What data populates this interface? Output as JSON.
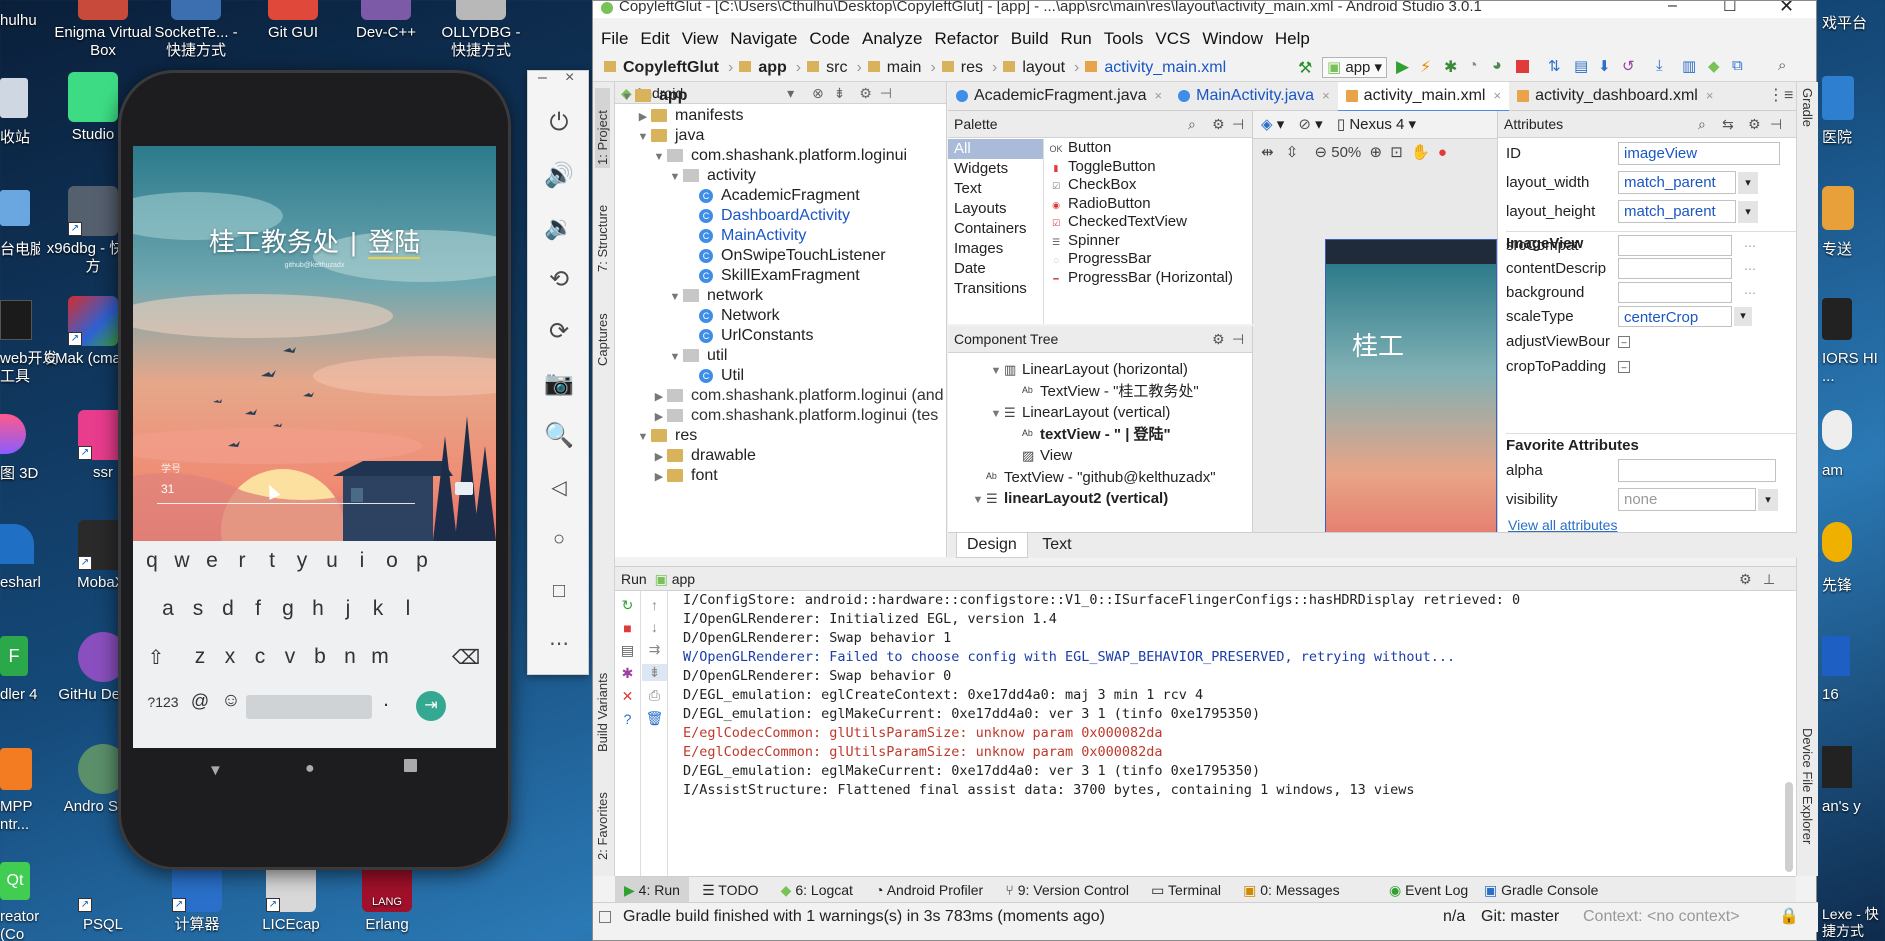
{
  "window": {
    "title": "CopyleftGlut - [C:\\Users\\Cthulhu\\Desktop\\CopyleftGlut] - [app] - ...\\app\\src\\main\\res\\layout\\activity_main.xml - Android Studio 3.0.1"
  },
  "menu": [
    "File",
    "Edit",
    "View",
    "Navigate",
    "Code",
    "Analyze",
    "Refactor",
    "Build",
    "Run",
    "Tools",
    "VCS",
    "Window",
    "Help"
  ],
  "breadcrumb": [
    "CopyleftGlut",
    "app",
    "src",
    "main",
    "res",
    "layout",
    "activity_main.xml"
  ],
  "toolbar": {
    "run_config": "app"
  },
  "project": {
    "view": "Android",
    "tree": [
      "app",
      "manifests",
      "java",
      "com.shashank.platform.loginui",
      "activity",
      "AcademicFragment",
      "DashboardActivity",
      "MainActivity",
      "OnSwipeTouchListener",
      "SkillExamFragment",
      "network",
      "Network",
      "UrlConstants",
      "util",
      "Util",
      "com.shashank.platform.loginui (and",
      "com.shashank.platform.loginui (tes",
      "res",
      "drawable",
      "font"
    ]
  },
  "editor_tabs": [
    "AcademicFragment.java",
    "MainActivity.java",
    "activity_main.xml",
    "activity_dashboard.xml"
  ],
  "palette": {
    "title": "Palette",
    "categories": [
      "All",
      "Widgets",
      "Text",
      "Layouts",
      "Containers",
      "Images",
      "Date",
      "Transitions"
    ],
    "items": [
      "Button",
      "ToggleButton",
      "CheckBox",
      "RadioButton",
      "CheckedTextView",
      "Spinner",
      "ProgressBar",
      "ProgressBar (Horizontal)"
    ]
  },
  "design_toolbar": {
    "device": "Nexus 4",
    "zoom": "50%"
  },
  "component_tree": {
    "title": "Component Tree",
    "rows": [
      "LinearLayout (horizontal)",
      "TextView - \"桂工教务处\"",
      "LinearLayout (vertical)",
      "textView - \" | 登陆\"",
      "View",
      "TextView - \"github@kelthuzadx\"",
      "linearLayout2 (vertical)"
    ]
  },
  "design_tabs": [
    "Design",
    "Text"
  ],
  "attributes": {
    "title": "Attributes",
    "id": "imageView",
    "layout_width": "match_parent",
    "layout_height": "match_parent",
    "section": "ImageView",
    "rows": [
      "srcCompat",
      "contentDescrip",
      "background",
      "scaleType",
      "adjustViewBour",
      "cropToPadding"
    ],
    "scaleType": "centerCrop",
    "favorites": "Favorite Attributes",
    "alpha": "alpha",
    "visibility": "visibility",
    "visibility_value": "none",
    "view_all": "View all attributes"
  },
  "preview": {
    "text": "桂工"
  },
  "run": {
    "title": "Run",
    "config": "app",
    "log": [
      {
        "level": "I",
        "text": "I/ConfigStore: android::hardware::configstore::V1_0::ISurfaceFlingerConfigs::hasHDRDisplay retrieved: 0"
      },
      {
        "level": "I",
        "text": "I/OpenGLRenderer: Initialized EGL, version 1.4"
      },
      {
        "level": "D",
        "text": "D/OpenGLRenderer: Swap behavior 1"
      },
      {
        "level": "W",
        "text": "W/OpenGLRenderer: Failed to choose config with EGL_SWAP_BEHAVIOR_PRESERVED, retrying without..."
      },
      {
        "level": "D",
        "text": "D/OpenGLRenderer: Swap behavior 0"
      },
      {
        "level": "D",
        "text": "D/EGL_emulation: eglCreateContext: 0xe17dd4a0: maj 3 min 1 rcv 4"
      },
      {
        "level": "D",
        "text": "D/EGL_emulation: eglMakeCurrent: 0xe17dd4a0: ver 3 1 (tinfo 0xe1795350)"
      },
      {
        "level": "E",
        "text": "E/eglCodecCommon: glUtilsParamSize: unknow param 0x000082da"
      },
      {
        "level": "E",
        "text": "E/eglCodecCommon: glUtilsParamSize: unknow param 0x000082da"
      },
      {
        "level": "D",
        "text": "D/EGL_emulation: eglMakeCurrent: 0xe17dd4a0: ver 3 1 (tinfo 0xe1795350)"
      },
      {
        "level": "I",
        "text": "I/AssistStructure: Flattened final assist data: 3700 bytes, containing 1 windows, 13 views"
      }
    ]
  },
  "bottom_tabs": [
    "4: Run",
    "TODO",
    "6: Logcat",
    "Android Profiler",
    "9: Version Control",
    "Terminal",
    "0: Messages",
    "Event Log",
    "Gradle Console"
  ],
  "status": {
    "message": "Gradle build finished with 1 warnings(s) in 3s 783ms (moments ago)",
    "na": "n/a",
    "git": "Git: master",
    "context": "Context: <no context>"
  },
  "side_tabs": {
    "left": [
      "1: Project",
      "7: Structure",
      "Captures",
      "Build Variants",
      "2: Favorites"
    ],
    "right": [
      "Gradle",
      "Device File Explorer"
    ]
  },
  "phone": {
    "title": "桂工教务处",
    "separator": "|",
    "login": "登陆",
    "subtitle": "github@kelthuzadx",
    "field_label": "学号",
    "field_value": "31",
    "keyboard_rows": [
      [
        "q",
        "w",
        "e",
        "r",
        "t",
        "y",
        "u",
        "i",
        "o",
        "p"
      ],
      [
        "a",
        "s",
        "d",
        "f",
        "g",
        "h",
        "j",
        "k",
        "l"
      ],
      [
        "z",
        "x",
        "c",
        "v",
        "b",
        "n",
        "m"
      ]
    ],
    "sym_key": "?123",
    "at_key": "@",
    "period_key": "."
  },
  "desktop": {
    "icons": [
      {
        "label": "Enigma Virtual Box"
      },
      {
        "label": "SocketTe... - 快捷方式"
      },
      {
        "label": "Git GUI"
      },
      {
        "label": "Dev-C++"
      },
      {
        "label": "OLLYDBG - 快捷方式"
      },
      {
        "label": "Studio"
      },
      {
        "label": "x96dbg - 快捷方"
      },
      {
        "label": "CMak (cmake-"
      },
      {
        "label": "ssr"
      },
      {
        "label": "MobaXt"
      },
      {
        "label": "GitHu Deskto"
      },
      {
        "label": "Andro Studi"
      },
      {
        "label": "PSQL"
      },
      {
        "label": "计算器"
      },
      {
        "label": "LICEcap"
      },
      {
        "label": "Erlang"
      }
    ],
    "left_edge": [
      "hulhu",
      "收站",
      "台电脑",
      "web开发 工具",
      "图 3D",
      "eshark",
      "dler 4",
      "MPP ntr...",
      "reator (Co"
    ],
    "right_edge": [
      "戏平台",
      "医院",
      "专送",
      "IORS HI ...",
      "am",
      "先锋",
      "16",
      "an's y",
      "Lexe - 快捷方式"
    ]
  }
}
